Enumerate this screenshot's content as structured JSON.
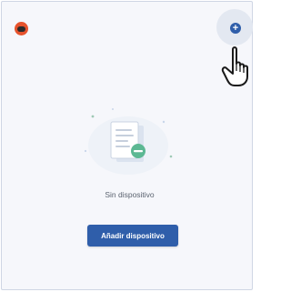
{
  "header": {
    "logo_icon": "app-logo-icon",
    "add_icon": "plus-circle-icon",
    "add_symbol": "+"
  },
  "empty_state": {
    "illustration_icon": "document-remove-icon",
    "message": "Sin dispositivo",
    "button_label": "Añadir dispositivo"
  },
  "cursor": {
    "icon": "hand-pointer-icon"
  },
  "colors": {
    "primary": "#2f5eaa",
    "background": "#f6f7fb",
    "logo": "#e6532d",
    "accent_green": "#4caf88"
  }
}
